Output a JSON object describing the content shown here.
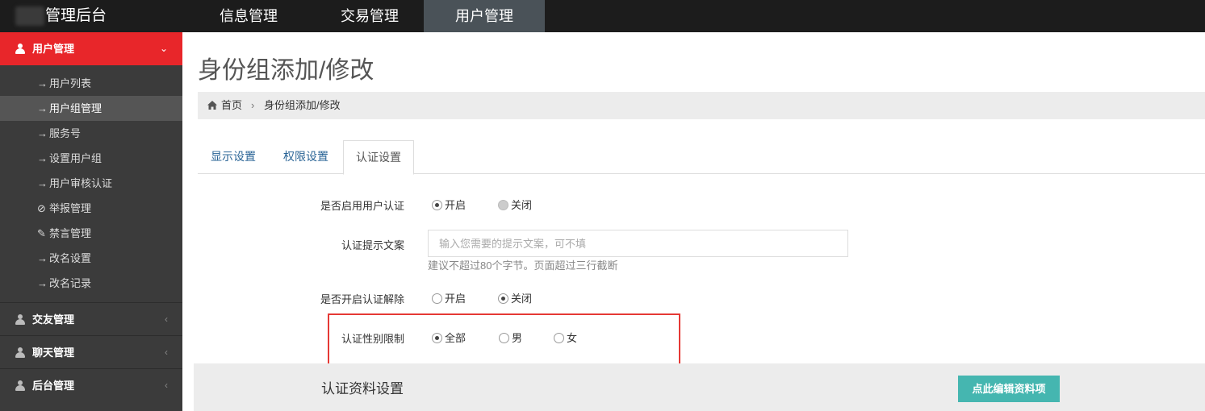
{
  "brand": {
    "title": "管理后台"
  },
  "topnav": [
    "信息管理",
    "交易管理",
    "用户管理"
  ],
  "sidebar": {
    "sections": [
      {
        "label": "用户管理",
        "arrow": "⌄"
      },
      {
        "label": "交友管理",
        "arrow": "‹"
      },
      {
        "label": "聊天管理",
        "arrow": "‹"
      },
      {
        "label": "后台管理",
        "arrow": "‹"
      }
    ],
    "items": [
      {
        "icon": "→",
        "label": "用户列表"
      },
      {
        "icon": "→",
        "label": "用户组管理"
      },
      {
        "icon": "→",
        "label": "服务号"
      },
      {
        "icon": "→",
        "label": "设置用户组"
      },
      {
        "icon": "→",
        "label": "用户审核认证"
      },
      {
        "icon": "⊘",
        "label": "举报管理"
      },
      {
        "icon": "✎",
        "label": "禁言管理"
      },
      {
        "icon": "→",
        "label": "改名设置"
      },
      {
        "icon": "→",
        "label": "改名记录"
      }
    ]
  },
  "page": {
    "title": "身份组添加/修改"
  },
  "breadcrumb": {
    "home": "首页",
    "sep": "›",
    "current": "身份组添加/修改"
  },
  "tabs": [
    "显示设置",
    "权限设置",
    "认证设置"
  ],
  "form": {
    "enable_auth": {
      "label": "是否启用用户认证",
      "options": [
        "开启",
        "关闭"
      ],
      "selected": "开启"
    },
    "hint_text": {
      "label": "认证提示文案",
      "value": "",
      "placeholder": "输入您需要的提示文案，可不填",
      "help": "建议不超过80个字节。页面超过三行截断"
    },
    "enable_unbind": {
      "label": "是否开启认证解除",
      "options": [
        "开启",
        "关闭"
      ],
      "selected": "关闭"
    },
    "gender_limit": {
      "label": "认证性别限制",
      "options": [
        "全部",
        "男",
        "女"
      ],
      "selected": "全部"
    }
  },
  "section": {
    "title": "认证资料设置",
    "edit_button": "点此编辑资料项"
  }
}
